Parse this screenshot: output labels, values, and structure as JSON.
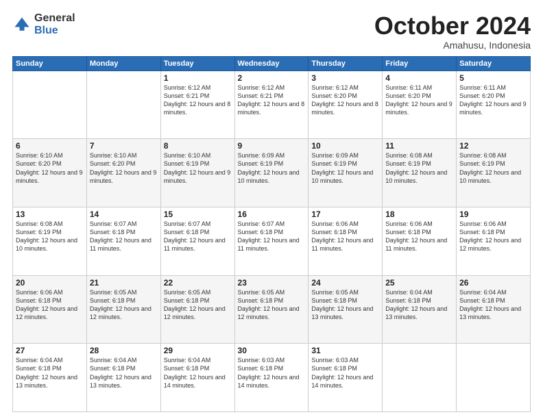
{
  "logo": {
    "general": "General",
    "blue": "Blue"
  },
  "header": {
    "month": "October 2024",
    "location": "Amahusu, Indonesia"
  },
  "weekdays": [
    "Sunday",
    "Monday",
    "Tuesday",
    "Wednesday",
    "Thursday",
    "Friday",
    "Saturday"
  ],
  "weeks": [
    [
      {
        "day": "",
        "info": ""
      },
      {
        "day": "",
        "info": ""
      },
      {
        "day": "1",
        "info": "Sunrise: 6:12 AM\nSunset: 6:21 PM\nDaylight: 12 hours and 8 minutes."
      },
      {
        "day": "2",
        "info": "Sunrise: 6:12 AM\nSunset: 6:21 PM\nDaylight: 12 hours and 8 minutes."
      },
      {
        "day": "3",
        "info": "Sunrise: 6:12 AM\nSunset: 6:20 PM\nDaylight: 12 hours and 8 minutes."
      },
      {
        "day": "4",
        "info": "Sunrise: 6:11 AM\nSunset: 6:20 PM\nDaylight: 12 hours and 9 minutes."
      },
      {
        "day": "5",
        "info": "Sunrise: 6:11 AM\nSunset: 6:20 PM\nDaylight: 12 hours and 9 minutes."
      }
    ],
    [
      {
        "day": "6",
        "info": "Sunrise: 6:10 AM\nSunset: 6:20 PM\nDaylight: 12 hours and 9 minutes."
      },
      {
        "day": "7",
        "info": "Sunrise: 6:10 AM\nSunset: 6:20 PM\nDaylight: 12 hours and 9 minutes."
      },
      {
        "day": "8",
        "info": "Sunrise: 6:10 AM\nSunset: 6:19 PM\nDaylight: 12 hours and 9 minutes."
      },
      {
        "day": "9",
        "info": "Sunrise: 6:09 AM\nSunset: 6:19 PM\nDaylight: 12 hours and 10 minutes."
      },
      {
        "day": "10",
        "info": "Sunrise: 6:09 AM\nSunset: 6:19 PM\nDaylight: 12 hours and 10 minutes."
      },
      {
        "day": "11",
        "info": "Sunrise: 6:08 AM\nSunset: 6:19 PM\nDaylight: 12 hours and 10 minutes."
      },
      {
        "day": "12",
        "info": "Sunrise: 6:08 AM\nSunset: 6:19 PM\nDaylight: 12 hours and 10 minutes."
      }
    ],
    [
      {
        "day": "13",
        "info": "Sunrise: 6:08 AM\nSunset: 6:19 PM\nDaylight: 12 hours and 10 minutes."
      },
      {
        "day": "14",
        "info": "Sunrise: 6:07 AM\nSunset: 6:18 PM\nDaylight: 12 hours and 11 minutes."
      },
      {
        "day": "15",
        "info": "Sunrise: 6:07 AM\nSunset: 6:18 PM\nDaylight: 12 hours and 11 minutes."
      },
      {
        "day": "16",
        "info": "Sunrise: 6:07 AM\nSunset: 6:18 PM\nDaylight: 12 hours and 11 minutes."
      },
      {
        "day": "17",
        "info": "Sunrise: 6:06 AM\nSunset: 6:18 PM\nDaylight: 12 hours and 11 minutes."
      },
      {
        "day": "18",
        "info": "Sunrise: 6:06 AM\nSunset: 6:18 PM\nDaylight: 12 hours and 11 minutes."
      },
      {
        "day": "19",
        "info": "Sunrise: 6:06 AM\nSunset: 6:18 PM\nDaylight: 12 hours and 12 minutes."
      }
    ],
    [
      {
        "day": "20",
        "info": "Sunrise: 6:06 AM\nSunset: 6:18 PM\nDaylight: 12 hours and 12 minutes."
      },
      {
        "day": "21",
        "info": "Sunrise: 6:05 AM\nSunset: 6:18 PM\nDaylight: 12 hours and 12 minutes."
      },
      {
        "day": "22",
        "info": "Sunrise: 6:05 AM\nSunset: 6:18 PM\nDaylight: 12 hours and 12 minutes."
      },
      {
        "day": "23",
        "info": "Sunrise: 6:05 AM\nSunset: 6:18 PM\nDaylight: 12 hours and 12 minutes."
      },
      {
        "day": "24",
        "info": "Sunrise: 6:05 AM\nSunset: 6:18 PM\nDaylight: 12 hours and 13 minutes."
      },
      {
        "day": "25",
        "info": "Sunrise: 6:04 AM\nSunset: 6:18 PM\nDaylight: 12 hours and 13 minutes."
      },
      {
        "day": "26",
        "info": "Sunrise: 6:04 AM\nSunset: 6:18 PM\nDaylight: 12 hours and 13 minutes."
      }
    ],
    [
      {
        "day": "27",
        "info": "Sunrise: 6:04 AM\nSunset: 6:18 PM\nDaylight: 12 hours and 13 minutes."
      },
      {
        "day": "28",
        "info": "Sunrise: 6:04 AM\nSunset: 6:18 PM\nDaylight: 12 hours and 13 minutes."
      },
      {
        "day": "29",
        "info": "Sunrise: 6:04 AM\nSunset: 6:18 PM\nDaylight: 12 hours and 14 minutes."
      },
      {
        "day": "30",
        "info": "Sunrise: 6:03 AM\nSunset: 6:18 PM\nDaylight: 12 hours and 14 minutes."
      },
      {
        "day": "31",
        "info": "Sunrise: 6:03 AM\nSunset: 6:18 PM\nDaylight: 12 hours and 14 minutes."
      },
      {
        "day": "",
        "info": ""
      },
      {
        "day": "",
        "info": ""
      }
    ]
  ]
}
